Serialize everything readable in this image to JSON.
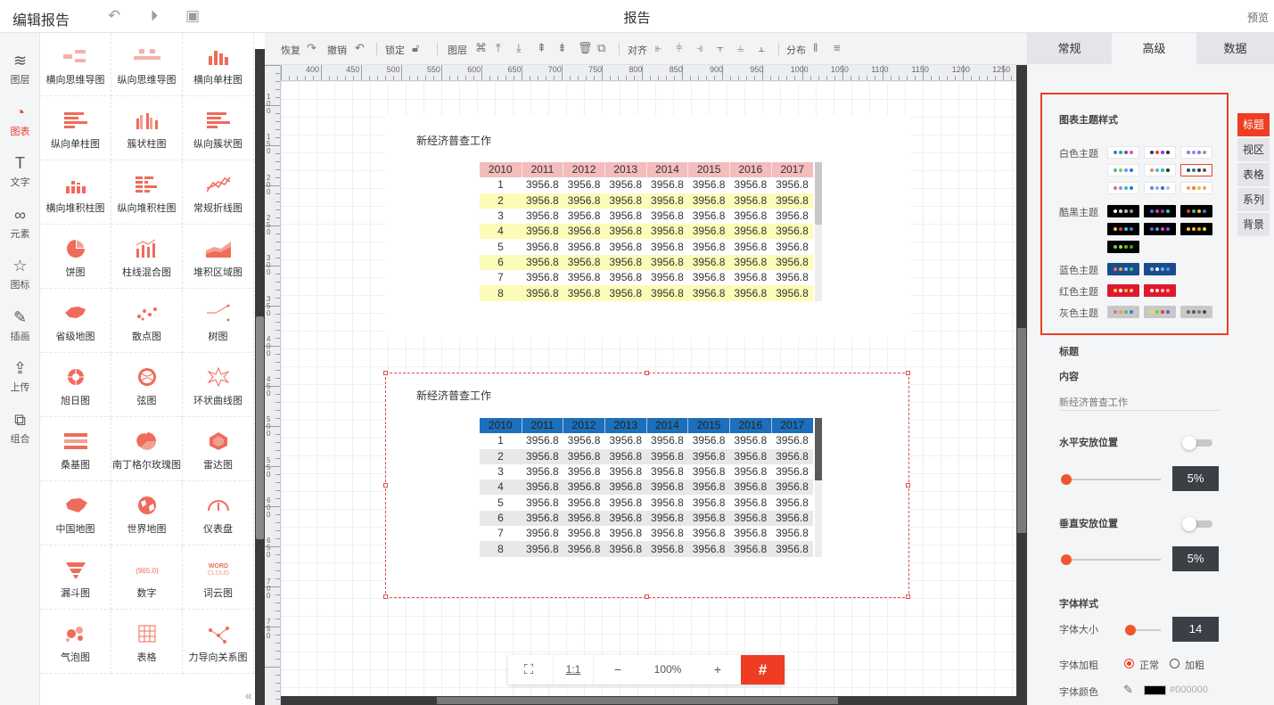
{
  "app_title": "编辑报告",
  "doc_title": "报告",
  "preview_label": "预览",
  "left_nav": [
    {
      "label": "图层",
      "icon": "layers-icon"
    },
    {
      "label": "图表",
      "icon": "chart-icon"
    },
    {
      "label": "文字",
      "icon": "text-icon"
    },
    {
      "label": "元素",
      "icon": "elements-icon"
    },
    {
      "label": "图标",
      "icon": "star-icon"
    },
    {
      "label": "插画",
      "icon": "illustration-icon"
    },
    {
      "label": "上传",
      "icon": "upload-icon"
    },
    {
      "label": "组合",
      "icon": "group-icon"
    }
  ],
  "components": [
    "横向思维导图",
    "纵向思维导图",
    "横向单柱图",
    "纵向单柱图",
    "簇状柱图",
    "纵向簇状图",
    "横向堆积柱图",
    "纵向堆积柱图",
    "常规折线图",
    "饼图",
    "柱线混合图",
    "堆积区域图",
    "省级地图",
    "散点图",
    "树图",
    "旭日图",
    "弦图",
    "环状曲线图",
    "桑基图",
    "南丁格尔玫瑰图",
    "雷达图",
    "中国地图",
    "世界地图",
    "仪表盘",
    "漏斗图",
    "数字",
    "词云图",
    "气泡图",
    "表格",
    "力导向关系图"
  ],
  "number_icon_text": "965.0",
  "wordcloud_icon_text": "WORD CLOUD",
  "toolbar": {
    "redo": "恢复",
    "undo": "撤销",
    "lock": "锁定",
    "layer": "图层",
    "align": "对齐",
    "distribute": "分布"
  },
  "ruler_labels": [
    "400",
    "450",
    "500",
    "550",
    "600",
    "650",
    "700",
    "750",
    "800",
    "850",
    "900",
    "950",
    "1000",
    "1050",
    "1100",
    "1150",
    "1200",
    "1250"
  ],
  "vruler_labels": [
    "100",
    "150",
    "200",
    "250",
    "300",
    "350",
    "400",
    "450",
    "500",
    "550",
    "600",
    "650",
    "700",
    "750"
  ],
  "widgets": [
    {
      "title": "新经济普查工作",
      "header": [
        "2010",
        "2011",
        "2012",
        "2013",
        "2014",
        "2015",
        "2016",
        "2017"
      ],
      "rows": [
        [
          "1",
          "3956.8",
          "3956.8",
          "3956.8",
          "3956.8",
          "3956.8",
          "3956.8",
          "3956.8"
        ],
        [
          "2",
          "3956.8",
          "3956.8",
          "3956.8",
          "3956.8",
          "3956.8",
          "3956.8",
          "3956.8"
        ],
        [
          "3",
          "3956.8",
          "3956.8",
          "3956.8",
          "3956.8",
          "3956.8",
          "3956.8",
          "3956.8"
        ],
        [
          "4",
          "3956.8",
          "3956.8",
          "3956.8",
          "3956.8",
          "3956.8",
          "3956.8",
          "3956.8"
        ],
        [
          "5",
          "3956.8",
          "3956.8",
          "3956.8",
          "3956.8",
          "3956.8",
          "3956.8",
          "3956.8"
        ],
        [
          "6",
          "3956.8",
          "3956.8",
          "3956.8",
          "3956.8",
          "3956.8",
          "3956.8",
          "3956.8"
        ],
        [
          "7",
          "3956.8",
          "3956.8",
          "3956.8",
          "3956.8",
          "3956.8",
          "3956.8",
          "3956.8"
        ],
        [
          "8",
          "3956.8",
          "3956.8",
          "3956.8",
          "3956.8",
          "3956.8",
          "3956.8",
          "3956.8"
        ]
      ]
    },
    {
      "title": "新经济普查工作",
      "header": [
        "2010",
        "2011",
        "2012",
        "2013",
        "2014",
        "2015",
        "2016",
        "2017"
      ],
      "rows": [
        [
          "1",
          "3956.8",
          "3956.8",
          "3956.8",
          "3956.8",
          "3956.8",
          "3956.8",
          "3956.8"
        ],
        [
          "2",
          "3956.8",
          "3956.8",
          "3956.8",
          "3956.8",
          "3956.8",
          "3956.8",
          "3956.8"
        ],
        [
          "3",
          "3956.8",
          "3956.8",
          "3956.8",
          "3956.8",
          "3956.8",
          "3956.8",
          "3956.8"
        ],
        [
          "4",
          "3956.8",
          "3956.8",
          "3956.8",
          "3956.8",
          "3956.8",
          "3956.8",
          "3956.8"
        ],
        [
          "5",
          "3956.8",
          "3956.8",
          "3956.8",
          "3956.8",
          "3956.8",
          "3956.8",
          "3956.8"
        ],
        [
          "6",
          "3956.8",
          "3956.8",
          "3956.8",
          "3956.8",
          "3956.8",
          "3956.8",
          "3956.8"
        ],
        [
          "7",
          "3956.8",
          "3956.8",
          "3956.8",
          "3956.8",
          "3956.8",
          "3956.8",
          "3956.8"
        ],
        [
          "8",
          "3956.8",
          "3956.8",
          "3956.8",
          "3956.8",
          "3956.8",
          "3956.8",
          "3956.8"
        ]
      ]
    }
  ],
  "zoom": {
    "fit_label": "1:1",
    "minus": "−",
    "value": "100%",
    "plus": "+"
  },
  "right_panel": {
    "tabs": [
      "常规",
      "高级",
      "数据"
    ],
    "active_tab": "高级",
    "theme_heading": "图表主题样式",
    "theme_groups": [
      {
        "label": "白色主题"
      },
      {
        "label": "酷黑主题"
      },
      {
        "label": "蓝色主题"
      },
      {
        "label": "红色主题"
      },
      {
        "label": "灰色主题"
      }
    ],
    "side_tabs": [
      "标题",
      "视区",
      "表格",
      "系列",
      "背景"
    ],
    "title_label": "标题",
    "content_label": "内容",
    "content_value": "新经济普查工作",
    "h_pos_label": "水平安放位置",
    "h_pos_value": "5%",
    "v_pos_label": "垂直安放位置",
    "v_pos_value": "5%",
    "font_style_label": "字体样式",
    "font_size_label": "字体大小",
    "font_size_value": "14",
    "font_weight_label": "字体加粗",
    "font_weight_normal": "正常",
    "font_weight_bold": "加粗",
    "font_color_label": "字体颜色",
    "font_color_value": "#000000"
  },
  "colors": {
    "accent": "#ee3d22",
    "table1_header": "#f4bcbc",
    "table1_stripe": "#fdfbb8",
    "table2_header": "#1c6fba",
    "table2_stripe": "#e8e8e8"
  }
}
